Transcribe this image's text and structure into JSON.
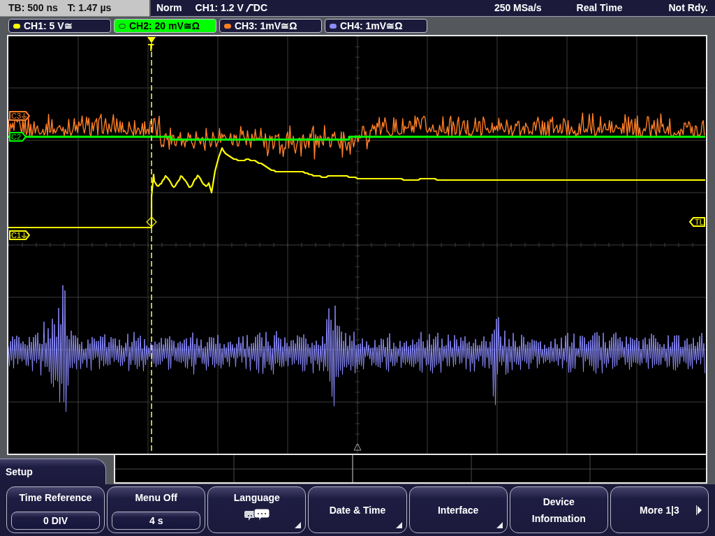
{
  "status_bar": {
    "timebase": "TB: 500 ns",
    "trigger_time": "T: 1.47 µs",
    "trigger_mode": "Norm",
    "trigger_source": "CH1: 1.2 V",
    "rising_edge": true,
    "trigger_coupling": "DC",
    "sample_rate": "250 MSa/s",
    "acquisition": "Real Time",
    "state": "Not Rdy."
  },
  "channels": [
    {
      "label": "CH1: 5 V≅",
      "color": "#ffff00",
      "selected": false
    },
    {
      "label": "CH2: 20 mV≅Ω",
      "color": "#00ff00",
      "selected": true
    },
    {
      "label": "CH3: 1mV≅Ω",
      "color": "#ff7f27",
      "selected": false
    },
    {
      "label": "CH4: 1mV≅Ω",
      "color": "#8c8cff",
      "selected": false
    }
  ],
  "display": {
    "trigger_marker": "T",
    "markers": [
      {
        "kind": "channel",
        "label": "C3",
        "color": "#ff7f27",
        "ground": true
      },
      {
        "kind": "channel",
        "label": "C2",
        "color": "#00ff00"
      },
      {
        "kind": "channel",
        "label": "C1",
        "color": "#ffff00",
        "ground": true
      },
      {
        "kind": "trigger_level",
        "label": "TL",
        "color": "#ffff00"
      }
    ]
  },
  "menu": {
    "title": "Setup",
    "buttons": [
      {
        "kind": "value",
        "label": "Time Reference",
        "value": "0 DIV"
      },
      {
        "kind": "value",
        "label": "Menu Off",
        "value": "4 s"
      },
      {
        "kind": "icon",
        "label": "Language",
        "submenu": true
      },
      {
        "kind": "text",
        "label": "Date & Time",
        "submenu": true
      },
      {
        "kind": "text",
        "label": "Interface",
        "submenu": true
      },
      {
        "kind": "text",
        "label": "Device Information",
        "submenu": false
      },
      {
        "kind": "next",
        "label": "More 1|3"
      }
    ]
  }
}
